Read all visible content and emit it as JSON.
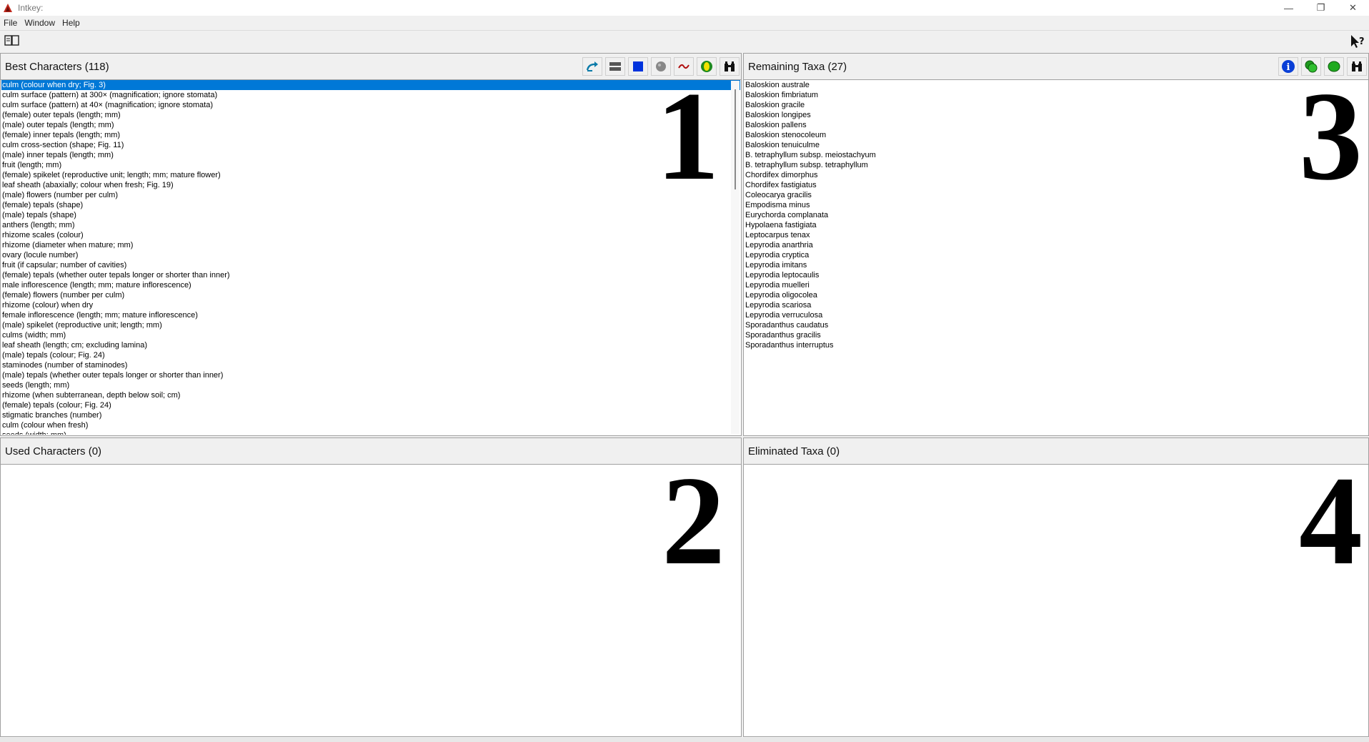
{
  "window": {
    "title": "Intkey:",
    "controls": {
      "minimize": "—",
      "restore": "❐",
      "close": "✕"
    }
  },
  "menu": [
    "File",
    "Window",
    "Help"
  ],
  "toolbar": {
    "left_icon": "book-icon",
    "right_icon": "context-help-icon"
  },
  "best_characters": {
    "title": "Best Characters (118)",
    "marker": "1",
    "tools": [
      "restart-icon",
      "order-icon",
      "square-icon",
      "circle-icon",
      "wave-icon",
      "yellow-circle-icon",
      "binoculars-icon"
    ],
    "items": [
      "culm (colour when dry; Fig. 3)",
      "culm surface (pattern) at 300× (magnification; ignore stomata)",
      "culm surface (pattern) at 40× (magnification; ignore stomata)",
      "(female) outer tepals (length; mm)",
      "(male) outer tepals (length; mm)",
      "(female) inner tepals (length; mm)",
      "culm cross-section (shape; Fig. 11)",
      "(male) inner tepals (length; mm)",
      "fruit (length; mm)",
      "(female) spikelet (reproductive unit; length; mm; mature flower)",
      "leaf sheath (abaxially; colour when fresh; Fig. 19)",
      "(male) flowers (number per culm)",
      "(female) tepals (shape)",
      "(male) tepals (shape)",
      "anthers (length; mm)",
      "rhizome scales (colour)",
      "rhizome (diameter when mature; mm)",
      "ovary (locule number)",
      "fruit (if capsular; number of cavities)",
      "(female) tepals (whether outer tepals longer or shorter than inner)",
      "male inflorescence (length; mm; mature inflorescence)",
      "(female) flowers (number per culm)",
      "rhizome (colour) when dry",
      "female inflorescence (length; mm; mature inflorescence)",
      "(male) spikelet (reproductive unit; length; mm)",
      "culms (width; mm)",
      "leaf sheath (length; cm; excluding lamina)",
      "(male) tepals (colour; Fig. 24)",
      "staminodes (number of staminodes)",
      "(male) tepals (whether outer tepals longer or shorter than inner)",
      "seeds (length; mm)",
      "rhizome (when subterranean, depth below soil; cm)",
      "(female) tepals (colour; Fig. 24)",
      "stigmatic branches (number)",
      "culm (colour when fresh)",
      "seeds (width; mm)"
    ],
    "selected_index": 0
  },
  "remaining_taxa": {
    "title": "Remaining Taxa (27)",
    "marker": "3",
    "tools": [
      "info-icon",
      "two-circles-icon",
      "green-ellipse-icon",
      "binoculars-icon"
    ],
    "items": [
      "Baloskion australe",
      "Baloskion fimbriatum",
      "Baloskion gracile",
      "Baloskion longipes",
      "Baloskion pallens",
      "Baloskion stenocoleum",
      "Baloskion tenuiculme",
      "B. tetraphyllum subsp. meiostachyum",
      "B. tetraphyllum subsp. tetraphyllum",
      "Chordifex dimorphus",
      "Chordifex fastigiatus",
      "Coleocarya gracilis",
      "Empodisma minus",
      "Eurychorda complanata",
      "Hypolaena fastigiata",
      "Leptocarpus tenax",
      "Lepyrodia anarthria",
      "Lepyrodia cryptica",
      "Lepyrodia imitans",
      "Lepyrodia leptocaulis",
      "Lepyrodia muelleri",
      "Lepyrodia oligocolea",
      "Lepyrodia scariosa",
      "Lepyrodia verruculosa",
      "Sporadanthus caudatus",
      "Sporadanthus gracilis",
      "Sporadanthus interruptus"
    ]
  },
  "used_characters": {
    "title": "Used Characters (0)",
    "marker": "2",
    "items": []
  },
  "eliminated_taxa": {
    "title": "Eliminated Taxa (0)",
    "marker": "4",
    "items": []
  }
}
